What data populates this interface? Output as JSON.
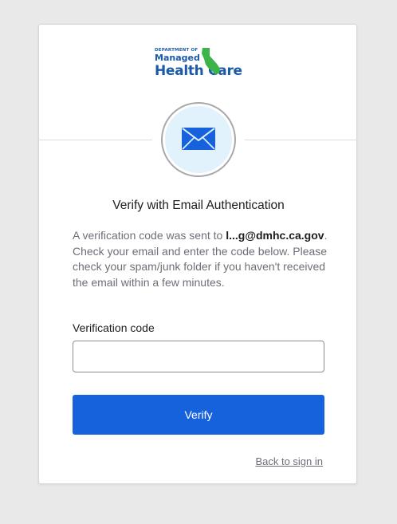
{
  "logo": {
    "line1": "DEPARTMENT OF",
    "line2": "Managed",
    "line3": "Health Care",
    "icon": "california-state-icon",
    "brand_blue": "#1b5aa6",
    "brand_green": "#3bb54a"
  },
  "badge": {
    "icon": "envelope-icon",
    "icon_color": "#1662dd",
    "background": "#e1f2fd"
  },
  "heading": "Verify with Email Authentication",
  "description": {
    "prefix": "A verification code was sent to ",
    "email": "l...g@dmhc.ca.gov",
    "suffix": ". Check your email and enter the code below. Please check your spam/junk folder if you haven't received the email within a few minutes."
  },
  "form": {
    "code_label": "Verification code",
    "code_value": "",
    "code_placeholder": ""
  },
  "actions": {
    "verify_label": "Verify",
    "back_label": "Back to sign in"
  },
  "colors": {
    "primary": "#1662dd",
    "page_bg": "#e9e9ea",
    "card_bg": "#ffffff"
  }
}
